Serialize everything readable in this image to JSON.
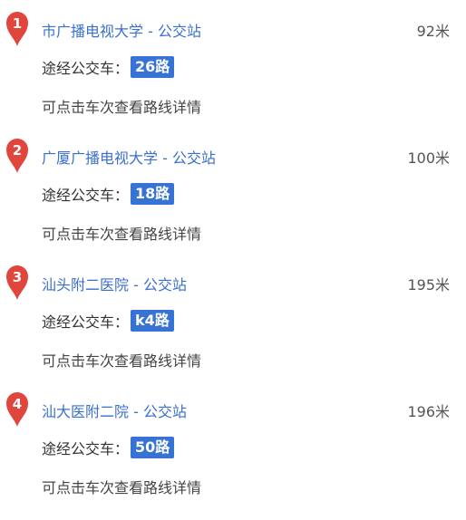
{
  "colors": {
    "link": "#3a6fcf",
    "badge_bg": "#3772d5",
    "marker": "#e0463b"
  },
  "bus_label": "途经公交车：",
  "stops": [
    {
      "number": "1",
      "name": "市广播电视大学 - 公交站",
      "distance": "92米",
      "routes": [
        "26路"
      ],
      "hint": "可点击车次查看路线详情",
      "icon": "map-pin-icon"
    },
    {
      "number": "2",
      "name": "广厦广播电视大学 - 公交站",
      "distance": "100米",
      "routes": [
        "18路"
      ],
      "hint": "可点击车次查看路线详情",
      "icon": "map-pin-icon"
    },
    {
      "number": "3",
      "name": "汕头附二医院 - 公交站",
      "distance": "195米",
      "routes": [
        "k4路"
      ],
      "hint": "可点击车次查看路线详情",
      "icon": "map-pin-icon"
    },
    {
      "number": "4",
      "name": "汕大医附二院 - 公交站",
      "distance": "196米",
      "routes": [
        "50路"
      ],
      "hint": "可点击车次查看路线详情",
      "icon": "map-pin-icon"
    }
  ]
}
